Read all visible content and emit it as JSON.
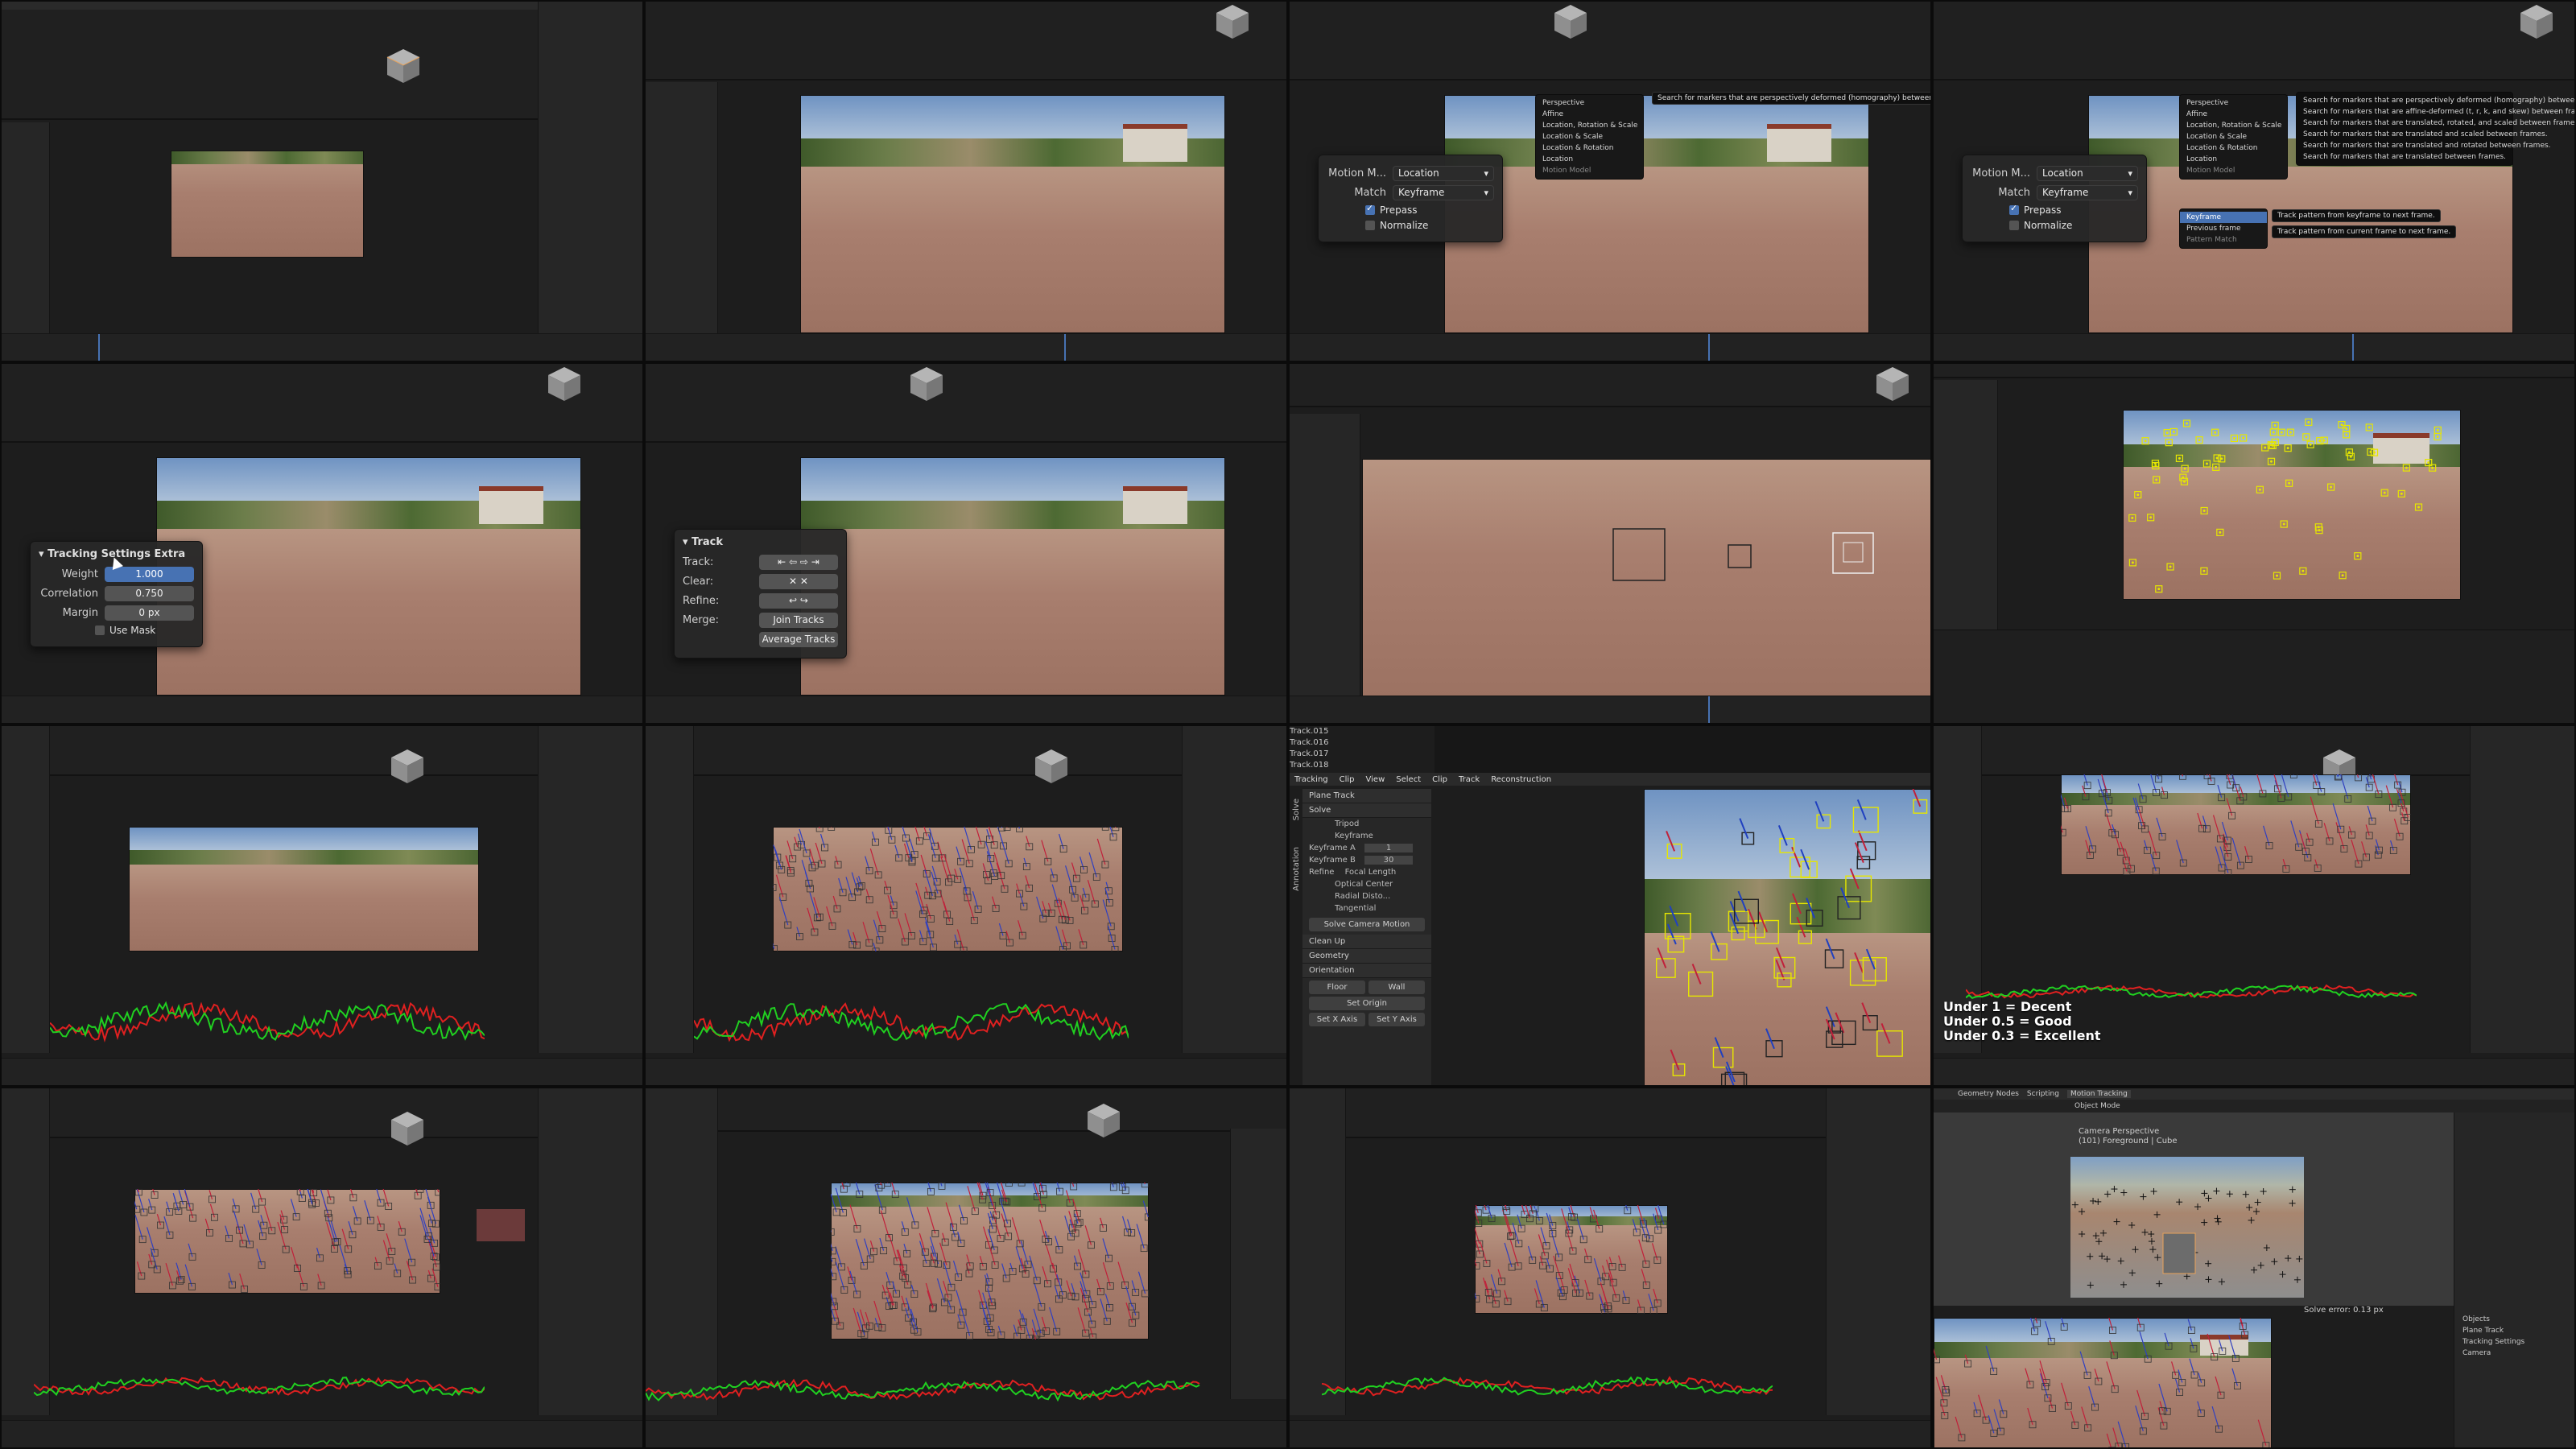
{
  "tile3_popup": {
    "motion_label": "Motion M...",
    "motion_value": "Location",
    "match_label": "Match",
    "match_value": "Keyframe",
    "prepass": "Prepass",
    "normalize": "Normalize"
  },
  "motion_menu": {
    "items": [
      "Perspective",
      "Affine",
      "Location, Rotation & Scale",
      "Location & Scale",
      "Location & Rotation",
      "Location"
    ],
    "title": "Motion Model",
    "tooltip": "Search for markers that are perspectively deformed (homography) between frames."
  },
  "motion_menu_tips": [
    "Search for markers that are perspectively deformed (homography) between frames.",
    "Search for markers that are affine-deformed (t, r, k, and skew) between frames.",
    "Search for markers that are translated, rotated, and scaled between frames.",
    "Search for markers that are translated and scaled between frames.",
    "Search for markers that are translated and rotated between frames.",
    "Search for markers that are translated between frames."
  ],
  "match_menu": {
    "items": [
      "Keyframe",
      "Previous frame"
    ],
    "title": "Pattern Match",
    "tips": [
      "Track pattern from keyframe to next frame.",
      "Track pattern from current frame to next frame."
    ]
  },
  "tracking_settings_extra": {
    "title": "Tracking Settings Extra",
    "weight_label": "Weight",
    "weight_value": "1.000",
    "correlation_label": "Correlation",
    "correlation_value": "0.750",
    "margin_label": "Margin",
    "margin_value": "0 px",
    "use_mask": "Use Mask"
  },
  "track_panel": {
    "title": "Track",
    "track_label": "Track:",
    "clear_label": "Clear:",
    "refine_label": "Refine:",
    "merge_label": "Merge:",
    "join_tracks": "Join Tracks",
    "average_tracks": "Average Tracks"
  },
  "solve_tile": {
    "tracks": [
      "Track.015",
      "Track.016",
      "Track.017",
      "Track.018"
    ],
    "header_items": [
      "Tracking",
      "Clip",
      "View",
      "Select",
      "Clip",
      "Track",
      "Reconstruction"
    ],
    "tabs": [
      "Solve",
      "Annotation"
    ],
    "plane_track": "Plane Track",
    "solve": "Solve",
    "tripod": "Tripod",
    "keyframe": "Keyframe",
    "keyframe_a_label": "Keyframe A",
    "keyframe_a": "1",
    "keyframe_b_label": "Keyframe B",
    "keyframe_b": "30",
    "refine": "Refine",
    "focal_length": "Focal Length",
    "optical_center": "Optical Center",
    "radial_distortion": "Radial Disto...",
    "tangential": "Tangential",
    "solve_button": "Solve Camera Motion",
    "clean_up": "Clean Up",
    "geometry": "Geometry",
    "orientation": "Orientation",
    "floor": "Floor",
    "wall": "Wall",
    "set_origin": "Set Origin",
    "set_x_axis": "Set X Axis",
    "set_y_axis": "Set Y Axis"
  },
  "solve_error_legend": {
    "line1": "Under 1 = Decent",
    "line2": "Under 0.5 = Good",
    "line3": "Under 0.3 = Excellent"
  },
  "final_tile": {
    "workspace_tabs": [
      "Geometry Nodes",
      "Scripting",
      "Motion Tracking"
    ],
    "object_mode": "Object Mode",
    "camera_perspective": "Camera Perspective",
    "collection": "(101) Foreground | Cube",
    "solve_error": "Solve error: 0.13 px",
    "outliner_items": [
      "Objects",
      "Plane Track",
      "Tracking Settings",
      "Camera"
    ]
  },
  "colors": {
    "blender_bg": "#1d1d1d",
    "accent_blue": "#4772b3",
    "marker_yellow": "#e6e600",
    "graph_red": "#e02020",
    "graph_green": "#20d020"
  }
}
